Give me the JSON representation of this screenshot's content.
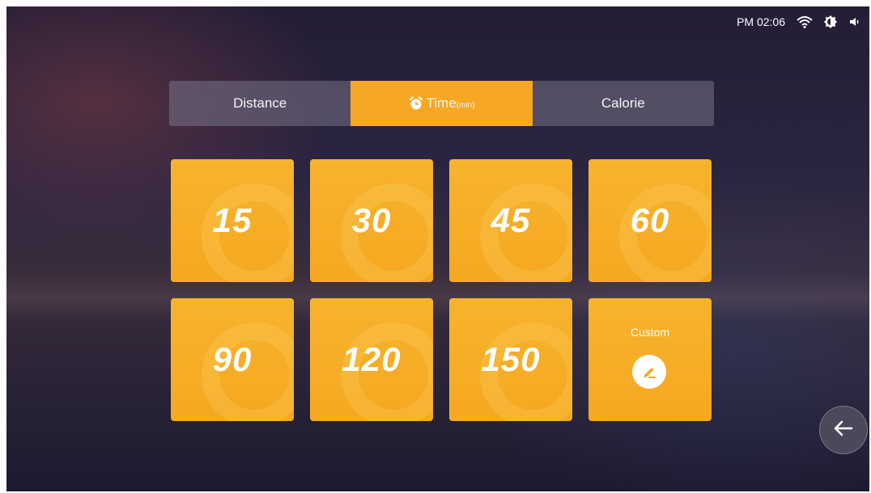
{
  "status_bar": {
    "time": "PM 02:06",
    "icons": [
      "wifi-icon",
      "brightness-icon",
      "volume-icon"
    ]
  },
  "tabs": [
    {
      "label": "Distance",
      "unit": "",
      "active": false
    },
    {
      "label": "Time",
      "unit": "(min)",
      "active": true,
      "icon": "alarm-clock-icon"
    },
    {
      "label": "Calorie",
      "unit": "",
      "active": false
    }
  ],
  "presets": [
    "15",
    "30",
    "45",
    "60",
    "90",
    "120",
    "150"
  ],
  "custom": {
    "label": "Custom",
    "icon": "edit-pencil-icon"
  },
  "back_button": {
    "icon": "arrow-left-icon"
  },
  "colors": {
    "accent": "#f6a723",
    "tab_bg": "#77738a",
    "text": "#ffffff"
  }
}
